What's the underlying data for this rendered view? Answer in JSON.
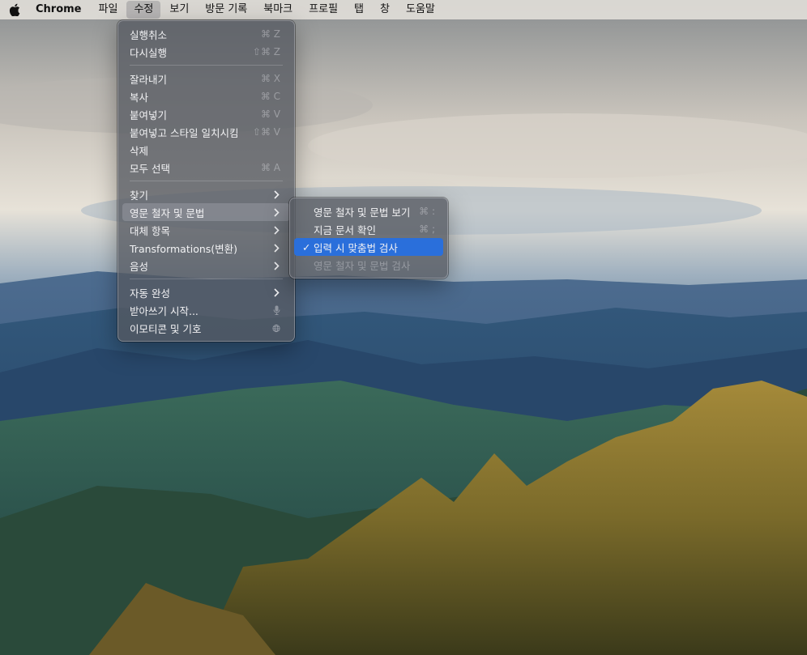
{
  "menubar": {
    "app_name": "Chrome",
    "items": [
      "파일",
      "수정",
      "보기",
      "방문 기록",
      "북마크",
      "프로필",
      "탭",
      "창",
      "도움말"
    ]
  },
  "edit_menu": {
    "undo": {
      "label": "실행취소",
      "shortcut": "⌘ Z"
    },
    "redo": {
      "label": "다시실행",
      "shortcut": "⇧⌘ Z"
    },
    "cut": {
      "label": "잘라내기",
      "shortcut": "⌘ X"
    },
    "copy": {
      "label": "복사",
      "shortcut": "⌘ C"
    },
    "paste": {
      "label": "붙여넣기",
      "shortcut": "⌘ V"
    },
    "paste_match": {
      "label": "붙여넣고 스타일 일치시킴",
      "shortcut": "⇧⌘ V"
    },
    "delete": {
      "label": "삭제"
    },
    "select_all": {
      "label": "모두 선택",
      "shortcut": "⌘ A"
    },
    "find": {
      "label": "찾기"
    },
    "spelling": {
      "label": "영문 철자 및 문법"
    },
    "substitutions": {
      "label": "대체 항목"
    },
    "transformations": {
      "label": "Transformations(변환)"
    },
    "speech": {
      "label": "음성"
    },
    "autofill": {
      "label": "자동 완성"
    },
    "dictation": {
      "label": "받아쓰기 시작..."
    },
    "emoji": {
      "label": "이모티콘 및 기호"
    }
  },
  "spelling_menu": {
    "show": {
      "label": "영문 철자 및 문법 보기",
      "shortcut": "⌘ :"
    },
    "check_now": {
      "label": "지금 문서 확인",
      "shortcut": "⌘ ;"
    },
    "check_while_typing": {
      "label": "입력 시 맞춤법 검사",
      "checkmark": "✓"
    },
    "check_grammar": {
      "label": "영문 철자 및 문법 검사"
    }
  },
  "colors": {
    "highlight_blue": "#2a6fdb"
  }
}
